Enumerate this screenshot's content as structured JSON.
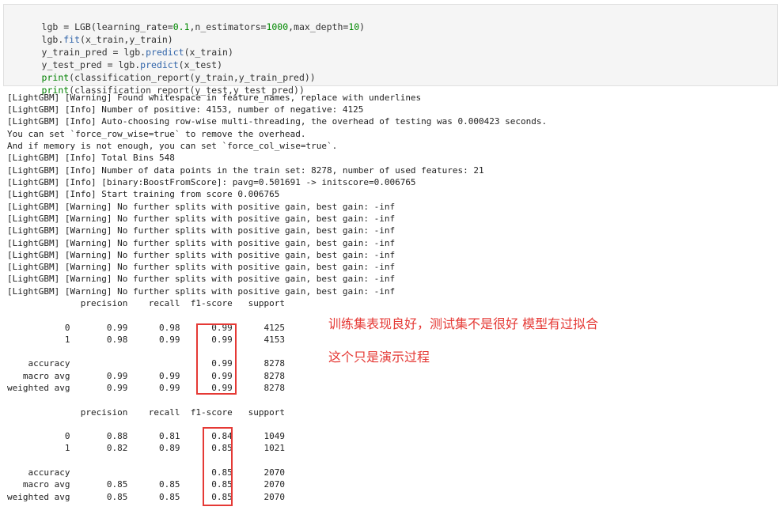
{
  "code_cell": {
    "lines": [
      [
        {
          "t": "lgb = LGB(learning_rate=",
          "c": "plain"
        },
        {
          "t": "0.1",
          "c": "num"
        },
        {
          "t": ",n_estimators=",
          "c": "plain"
        },
        {
          "t": "1000",
          "c": "num"
        },
        {
          "t": ",max_depth=",
          "c": "plain"
        },
        {
          "t": "10",
          "c": "num"
        },
        {
          "t": ")",
          "c": "plain"
        }
      ],
      [
        {
          "t": "lgb.",
          "c": "plain"
        },
        {
          "t": "fit",
          "c": "method"
        },
        {
          "t": "(x_train,y_train)",
          "c": "plain"
        }
      ],
      [
        {
          "t": "y_train_pred = lgb.",
          "c": "plain"
        },
        {
          "t": "predict",
          "c": "method"
        },
        {
          "t": "(x_train)",
          "c": "plain"
        }
      ],
      [
        {
          "t": "y_test_pred = lgb.",
          "c": "plain"
        },
        {
          "t": "predict",
          "c": "method"
        },
        {
          "t": "(x_test)",
          "c": "plain"
        }
      ],
      [
        {
          "t": "print",
          "c": "builtin"
        },
        {
          "t": "(classification_report(y_train,y_train_pred))",
          "c": "plain"
        }
      ],
      [
        {
          "t": "print",
          "c": "builtin"
        },
        {
          "t": "(classification_report(y_test,y_test_pred))",
          "c": "plain"
        }
      ]
    ]
  },
  "output_log": [
    "[LightGBM] [Warning] Found whitespace in feature_names, replace with underlines",
    "[LightGBM] [Info] Number of positive: 4153, number of negative: 4125",
    "[LightGBM] [Info] Auto-choosing row-wise multi-threading, the overhead of testing was 0.000423 seconds.",
    "You can set `force_row_wise=true` to remove the overhead.",
    "And if memory is not enough, you can set `force_col_wise=true`.",
    "[LightGBM] [Info] Total Bins 548",
    "[LightGBM] [Info] Number of data points in the train set: 8278, number of used features: 21",
    "[LightGBM] [Info] [binary:BoostFromScore]: pavg=0.501691 -> initscore=0.006765",
    "[LightGBM] [Info] Start training from score 0.006765",
    "[LightGBM] [Warning] No further splits with positive gain, best gain: -inf",
    "[LightGBM] [Warning] No further splits with positive gain, best gain: -inf",
    "[LightGBM] [Warning] No further splits with positive gain, best gain: -inf",
    "[LightGBM] [Warning] No further splits with positive gain, best gain: -inf",
    "[LightGBM] [Warning] No further splits with positive gain, best gain: -inf",
    "[LightGBM] [Warning] No further splits with positive gain, best gain: -inf",
    "[LightGBM] [Warning] No further splits with positive gain, best gain: -inf",
    "[LightGBM] [Warning] No further splits with positive gain, best gain: -inf"
  ],
  "train_report": [
    "              precision    recall  f1-score   support",
    "",
    "           0       0.99      0.98      0.99      4125",
    "           1       0.98      0.99      0.99      4153",
    "",
    "    accuracy                           0.99      8278",
    "   macro avg       0.99      0.99      0.99      8278",
    "weighted avg       0.99      0.99      0.99      8278"
  ],
  "test_report": [
    "              precision    recall  f1-score   support",
    "",
    "           0       0.88      0.81      0.84      1049",
    "           1       0.82      0.89      0.85      1021",
    "",
    "    accuracy                           0.85      2070",
    "   macro avg       0.85      0.85      0.85      2070",
    "weighted avg       0.85      0.85      0.85      2070"
  ],
  "annotations": {
    "line1": "训练集表现良好，测试集不是很好 模型有过拟合",
    "line2": "这个只是演示过程"
  },
  "colors": {
    "annotation_red": "#e53935",
    "number_green": "#008800",
    "method_blue": "#3366aa",
    "builtin_green": "#008000",
    "cell_background": "#f5f5f5"
  }
}
